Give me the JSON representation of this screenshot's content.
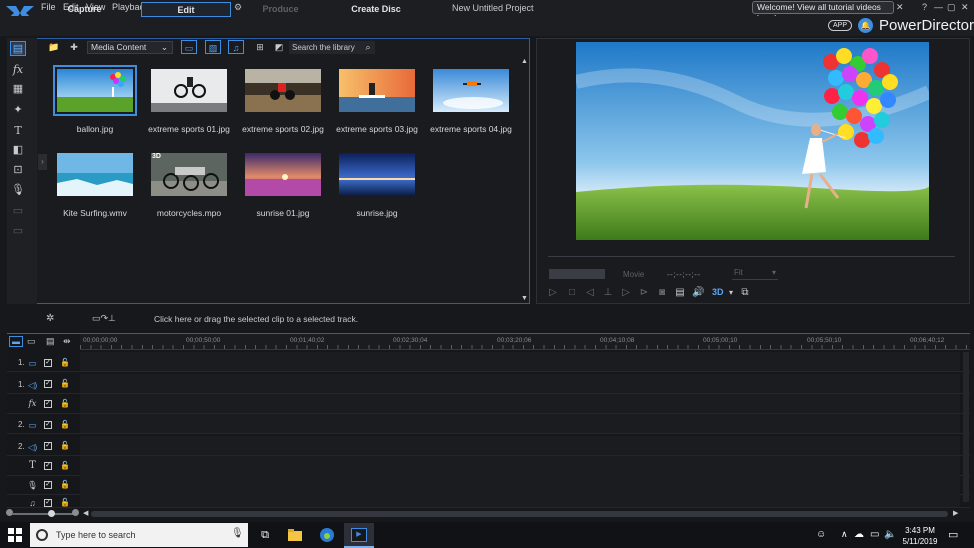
{
  "menubar": {
    "items": [
      "File",
      "Edit",
      "View",
      "Playback"
    ],
    "project_title": "New Untitled Project",
    "welcome": "Welcome! View all tutorial videos here!",
    "help": "?"
  },
  "modes": {
    "tabs": [
      {
        "label": "Capture",
        "state": "normal"
      },
      {
        "label": "Edit",
        "state": "active"
      },
      {
        "label": "Produce",
        "state": "disabled"
      },
      {
        "label": "Create Disc",
        "state": "normal"
      }
    ],
    "app_badge": "APP",
    "brand": "PowerDirector"
  },
  "library": {
    "filter": "Media Content",
    "search_placeholder": "Search the library",
    "items": [
      {
        "label": "ballon.jpg",
        "selected": true
      },
      {
        "label": "extreme sports 01.jpg"
      },
      {
        "label": "extreme sports 02.jpg"
      },
      {
        "label": "extreme sports 03.jpg"
      },
      {
        "label": "extreme sports 04.jpg"
      },
      {
        "label": "Kite Surfing.wmv"
      },
      {
        "label": "motorcycles.mpo",
        "badge": "3D"
      },
      {
        "label": "sunrise 01.jpg"
      },
      {
        "label": "sunrise.jpg"
      }
    ]
  },
  "preview": {
    "mode": "Movie",
    "timecode": "--;--;--;--",
    "fit": "Fit",
    "stereo": "3D"
  },
  "timeline": {
    "hint": "Click here or drag the selected clip to a selected track.",
    "ruler": [
      "00;00;00;00",
      "00;00;50;00",
      "00;01;40;02",
      "00;02;30;04",
      "00;03;20;06",
      "00;04;10;08",
      "00;05;00;10",
      "00;05;50;10",
      "00;06;40;12"
    ],
    "tracks": [
      {
        "label": "1.",
        "icon": "video-track-icon"
      },
      {
        "label": "1.",
        "icon": "audio-track-icon"
      },
      {
        "label": "",
        "icon": "fx-track-icon"
      },
      {
        "label": "2.",
        "icon": "video-track-icon"
      },
      {
        "label": "2.",
        "icon": "audio-track-icon"
      },
      {
        "label": "",
        "icon": "title-track-icon"
      },
      {
        "label": "",
        "icon": "voice-track-icon"
      },
      {
        "label": "",
        "icon": "music-track-icon"
      }
    ]
  },
  "taskbar": {
    "search_placeholder": "Type here to search",
    "time": "3:43 PM",
    "date": "5/11/2019"
  },
  "colors": {
    "accent": "#3f8de0",
    "background": "#17181c"
  }
}
